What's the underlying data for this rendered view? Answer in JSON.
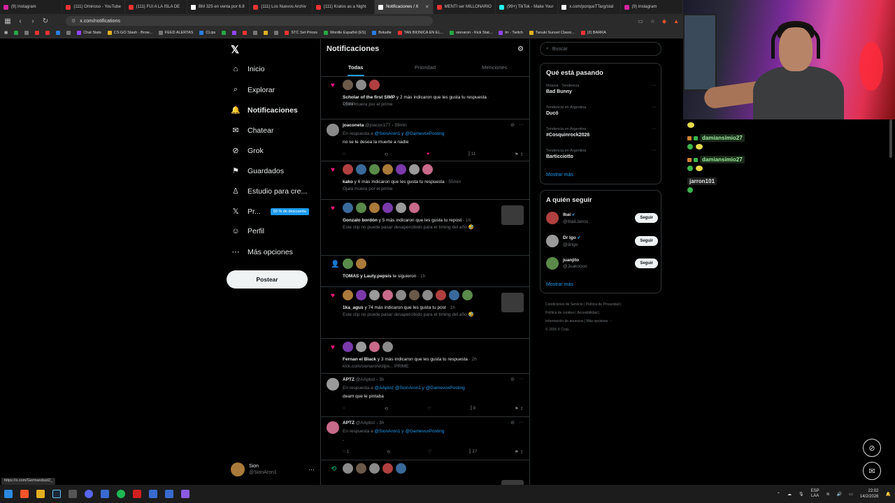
{
  "browser": {
    "tabs": [
      {
        "label": "(9) Instagram",
        "icon": "instagram-icon",
        "active": false
      },
      {
        "label": "(111) Ominoso - YouTube",
        "icon": "youtube-icon",
        "active": false
      },
      {
        "label": "(111) FUI A LA ISLA DE",
        "icon": "youtube-icon",
        "active": false
      },
      {
        "label": "BM 325 en venta por 6.8",
        "icon": "x-icon",
        "active": false
      },
      {
        "label": "(111) Los Nuevos Archiv",
        "icon": "youtube-icon",
        "active": false
      },
      {
        "label": "(111) Kratos as a Night",
        "icon": "youtube-icon",
        "active": false
      },
      {
        "label": "Notificaciones / X",
        "icon": "x-icon",
        "active": true
      },
      {
        "label": "MENTI ser MILLONARIO",
        "icon": "youtube-icon",
        "active": false
      },
      {
        "label": "(99+) TikTok - Make Your",
        "icon": "tiktok-icon",
        "active": false
      },
      {
        "label": "x.com/porqueTTarg/stat",
        "icon": "x-icon",
        "active": false
      },
      {
        "label": "(9) Instagram",
        "icon": "instagram-icon",
        "active": false
      }
    ],
    "url": "x.com/notifications",
    "bookmarks": [
      {
        "label": "",
        "color": "g"
      },
      {
        "label": "",
        "color": ""
      },
      {
        "label": "",
        "color": "r"
      },
      {
        "label": "",
        "color": "r"
      },
      {
        "label": "",
        "color": "b"
      },
      {
        "label": "",
        "color": ""
      },
      {
        "label": "Chat Stats",
        "color": "p"
      },
      {
        "label": "CS:GO Stash - Brow...",
        "color": "y"
      },
      {
        "label": "FEED ALERTAS",
        "color": ""
      },
      {
        "label": "CLips",
        "color": "b"
      },
      {
        "label": "",
        "color": "g"
      },
      {
        "label": "",
        "color": "p"
      },
      {
        "label": "",
        "color": "r"
      },
      {
        "label": "",
        "color": ""
      },
      {
        "label": "",
        "color": "y"
      },
      {
        "label": "",
        "color": ""
      },
      {
        "label": "STC Set Prices",
        "color": "r"
      },
      {
        "label": "Wordle Español (ES)",
        "color": "g"
      },
      {
        "label": "Boludle",
        "color": "b"
      },
      {
        "label": "TAN BIONICA EN EL...",
        "color": "r"
      },
      {
        "label": "sionaron - Kick Stat...",
        "color": "g"
      },
      {
        "label": "trr - Twitch",
        "color": "p"
      },
      {
        "label": "Tanuki Sunset Classi...",
        "color": "y"
      },
      {
        "label": "(2) BARRA",
        "color": "r"
      }
    ],
    "status_url": "https://x.com/Germandust2_"
  },
  "x": {
    "nav": {
      "items": [
        {
          "label": "Inicio",
          "icon": "home-icon",
          "glyph": "⌂"
        },
        {
          "label": "Explorar",
          "icon": "search-icon",
          "glyph": "⌕"
        },
        {
          "label": "Notificaciones",
          "icon": "bell-icon",
          "glyph": "🔔"
        },
        {
          "label": "Chatear",
          "icon": "mail-icon",
          "glyph": "✉"
        },
        {
          "label": "Grok",
          "icon": "grok-icon",
          "glyph": "⊘"
        },
        {
          "label": "Guardados",
          "icon": "bookmark-icon",
          "glyph": "⚑"
        },
        {
          "label": "Estudio para cre...",
          "icon": "creator-studio-icon",
          "glyph": "♙"
        },
        {
          "label": "Pr...",
          "icon": "x-premium-icon",
          "glyph": "𝕏"
        },
        {
          "label": "Perfil",
          "icon": "profile-icon",
          "glyph": "☺"
        },
        {
          "label": "Más opciones",
          "icon": "more-options-icon",
          "glyph": "⋯"
        }
      ],
      "premium_promo": "50 % de descuento",
      "post_label": "Postear",
      "profile_name": "Sion",
      "profile_handle": "@SionAron1"
    },
    "notifications": {
      "title": "Notificaciones",
      "tabs": [
        "Todas",
        "Prioridad",
        "Menciones"
      ],
      "items": [
        {
          "type": "like",
          "avatars": 3,
          "actor": "Scholar of the first SIMP",
          "text": " y 2 más indicaron que les gusta tu respuesta",
          "time": " · 14min",
          "sub": "Ojalá muera por el prime"
        },
        {
          "type": "reply",
          "name": "joaconeta",
          "handle": "@joacox177",
          "time": "39min",
          "to_prefix": "En respuesta a ",
          "to": "@SionAron1 y @GamevoxPosting",
          "body": "no se le desea la muerte a nadie",
          "likes": "",
          "views": "11",
          "liked": true
        },
        {
          "type": "like",
          "avatars": 7,
          "actor": "kako",
          "text": " y 6 más indicaron que les gusta tu respuesta",
          "time": " · 55min",
          "sub": "Ojalá muera por el prime"
        },
        {
          "type": "like",
          "avatars": 6,
          "actor": "Gonzalo bordón",
          "text": " y 5 más indicaron que les gusta tu repost",
          "time": " · 1h",
          "sub": "Este clip no puede pasar desapercibido para el timing del año 🤣"
        },
        {
          "type": "follow",
          "avatars": 2,
          "actor": "TOMAS y Lauty.pepsis",
          "text": " te siguieron",
          "time": " · 1h",
          "sub": ""
        },
        {
          "type": "like",
          "avatars": 10,
          "actor": "1ka_agus",
          "text": " y 74 más indicaron que les gusta tu post",
          "time": " · 1h",
          "sub": "Este clip no puede pasar desapercibido para el timing del año 🤣"
        },
        {
          "type": "like",
          "avatars": 4,
          "actor": "Fernan el Black",
          "text": " y 3 más indicaron que les gusta tu respuesta",
          "time": " · 2h",
          "sub": "kick.com/sionaron/clips... PRIME"
        },
        {
          "type": "reply",
          "name": "APTZ",
          "handle": "@AAptoz",
          "time": "3h",
          "to_prefix": "En respuesta a ",
          "to": "@AAptoz @SionAron1 y @GamevoxPosting",
          "body": "deam que le pintaba",
          "likes": "",
          "views": "9",
          "liked": false
        },
        {
          "type": "reply",
          "name": "APTZ",
          "handle": "@AAptoz",
          "time": "3h",
          "to_prefix": "En respuesta a ",
          "to": "@SionAron1 y @GamevoxPosting",
          "body": ".",
          "likes": "1",
          "views": "37",
          "liked": false
        },
        {
          "type": "repost",
          "avatars": 5,
          "actor": "",
          "text": "",
          "time": "",
          "sub": ""
        }
      ]
    },
    "right": {
      "search_placeholder": "Buscar",
      "trends_title": "Qué está pasando",
      "trends": [
        {
          "context": "Música · Tendencia",
          "name": "Bad Bunny"
        },
        {
          "context": "Tendencia en Argentina",
          "name": "Ducó"
        },
        {
          "context": "Tendencia en Argentina",
          "name": "#Cosquinrock2026"
        },
        {
          "context": "Tendencia en Argentina",
          "name": "Barticciotto"
        }
      ],
      "show_more": "Mostrar más",
      "follow_title": "A quién seguir",
      "follow": [
        {
          "name": "Ibai",
          "handle": "@IbaiLlanos",
          "verified": true
        },
        {
          "name": "Dr Igo",
          "handle": "@drIgo",
          "verified": true
        },
        {
          "name": "juanjito",
          "handle": "@Juakoooo",
          "verified": false
        }
      ],
      "follow_button": "Seguir",
      "footer": [
        "Condiciones de Servicio  |  Política de Privacidad  |",
        "Política de cookies  |  Accesibilidad  |",
        "Información de anuncios  |  Más opciones ···",
        "© 2026 X Corp."
      ]
    }
  },
  "chat": {
    "lines": [
      {
        "user": "damiansimio27",
        "style": "green"
      },
      {
        "user": "damiansimio27",
        "style": "green"
      },
      {
        "user": "jarron101",
        "style": "plain"
      }
    ]
  },
  "taskbar": {
    "lang": "ESP",
    "lang2": "LAA",
    "time": "22:02",
    "date": "14/2/2026"
  }
}
